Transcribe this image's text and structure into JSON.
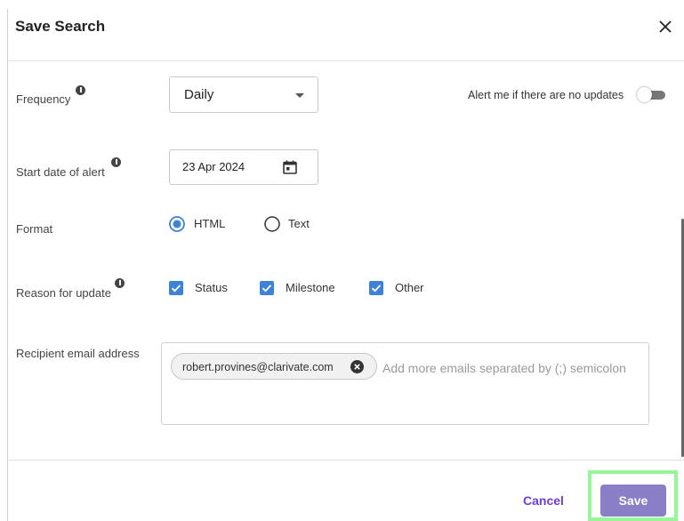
{
  "dialog": {
    "title": "Save Search",
    "close_icon": "close-icon"
  },
  "frequency": {
    "label": "Frequency",
    "value": "Daily",
    "info_icon": "info-icon"
  },
  "no_updates_alert": {
    "label": "Alert me if there are no updates",
    "enabled": false
  },
  "start_date": {
    "label": "Start date of alert",
    "value": "23 Apr 2024",
    "icon": "calendar-icon"
  },
  "format": {
    "label": "Format",
    "options": [
      {
        "label": "HTML",
        "selected": true
      },
      {
        "label": "Text",
        "selected": false
      }
    ]
  },
  "reason": {
    "label": "Reason for update",
    "options": [
      {
        "label": "Status",
        "checked": true
      },
      {
        "label": "Milestone",
        "checked": true
      },
      {
        "label": "Other",
        "checked": true
      }
    ]
  },
  "recipients": {
    "label": "Recipient email address",
    "chips": [
      "robert.provines@clarivate.com"
    ],
    "placeholder": "Add more emails separated by (;) semicolon"
  },
  "footer": {
    "cancel_label": "Cancel",
    "save_label": "Save"
  },
  "colors": {
    "accent": "#3e82d7",
    "save_button": "#8a7ec6",
    "cancel_text": "#6b3fd6",
    "highlight": "#99f59a"
  }
}
